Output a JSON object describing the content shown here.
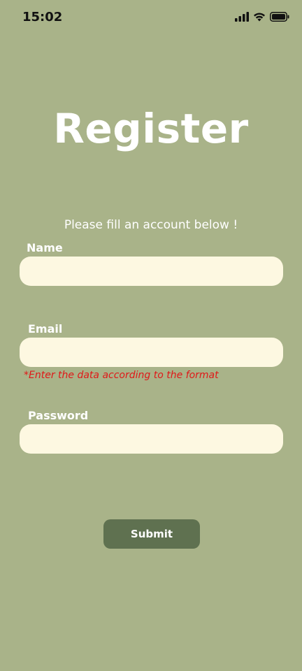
{
  "status_bar": {
    "time": "15:02",
    "icons": [
      "signal-icon",
      "wifi-icon",
      "battery-icon"
    ]
  },
  "form": {
    "title": "Register",
    "subtitle": "Please fill an account below !",
    "fields": [
      {
        "label": "Name",
        "value": "",
        "placeholder": ""
      },
      {
        "label": "Email",
        "value": "",
        "placeholder": "",
        "error": "*Enter the data according to the format"
      },
      {
        "label": "Password",
        "value": "",
        "placeholder": ""
      }
    ],
    "submit_label": "Submit"
  },
  "colors": {
    "background": "#a9b389",
    "input_background": "#fdf8e1",
    "button_background": "#5f7150",
    "error": "#e01818",
    "text": "#ffffff"
  }
}
